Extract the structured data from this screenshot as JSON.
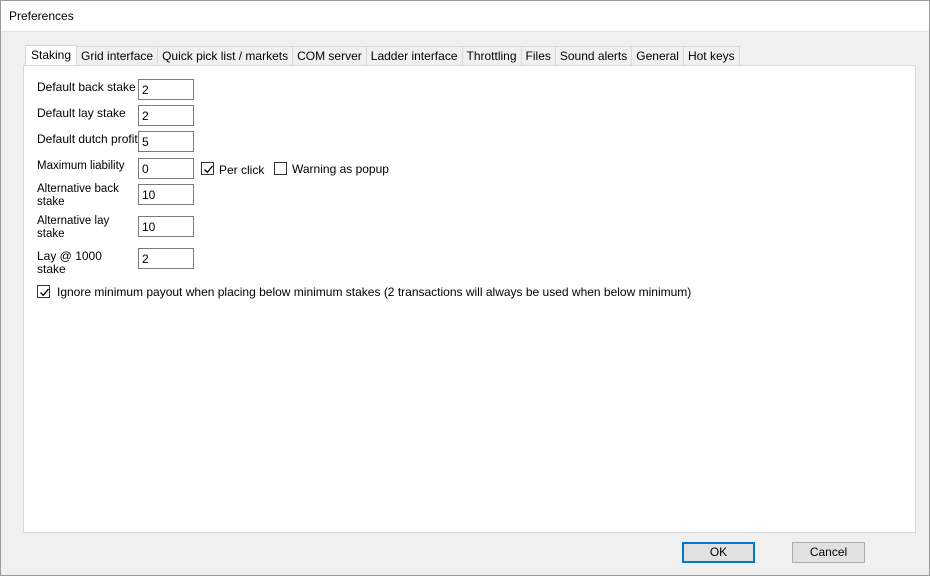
{
  "window": {
    "title": "Preferences"
  },
  "tabs": [
    {
      "label": "Staking",
      "active": true
    },
    {
      "label": "Grid interface"
    },
    {
      "label": "Quick pick list / markets"
    },
    {
      "label": "COM server"
    },
    {
      "label": "Ladder interface"
    },
    {
      "label": "Throttling"
    },
    {
      "label": "Files"
    },
    {
      "label": "Sound alerts"
    },
    {
      "label": "General"
    },
    {
      "label": "Hot keys"
    }
  ],
  "staking": {
    "default_back_stake": {
      "label": "Default back stake",
      "value": "2"
    },
    "default_lay_stake": {
      "label": "Default lay stake",
      "value": "2"
    },
    "default_dutch_profit": {
      "label": "Default dutch profit",
      "value": "5"
    },
    "maximum_liability": {
      "label": "Maximum liability",
      "value": "0"
    },
    "alternative_back_stake": {
      "label_line1": "Alternative back",
      "label_line2": "stake",
      "value": "10"
    },
    "alternative_lay_stake": {
      "label_line1": "Alternative lay",
      "label_line2": "stake",
      "value": "10"
    },
    "lay_1000_stake": {
      "label_line1": "Lay @ 1000",
      "label_line2": "stake",
      "value": "2"
    },
    "per_click": {
      "label": "Per click",
      "checked": true
    },
    "warning_as_popup": {
      "label": "Warning as popup",
      "checked": false
    },
    "ignore_minimum_payout": {
      "label": "Ignore minimum payout when placing below minimum stakes (2 transactions will always be used when below minimum)",
      "checked": true
    }
  },
  "buttons": {
    "ok": "OK",
    "cancel": "Cancel"
  },
  "colors": {
    "focus_border": "#0078d7",
    "panel_bg": "#ffffff",
    "window_bg": "#f0f0f0"
  }
}
